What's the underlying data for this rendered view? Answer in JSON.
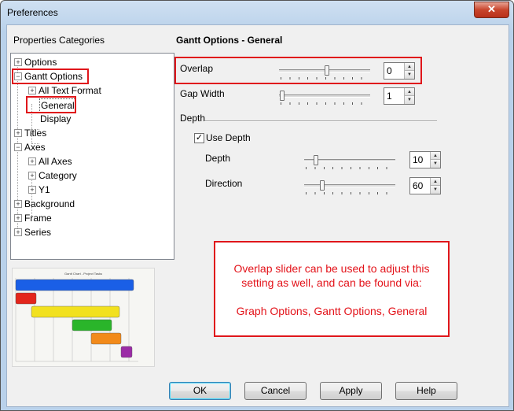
{
  "window": {
    "title": "Preferences",
    "close_symbol": "✕"
  },
  "left_panel": {
    "label": "Properties Categories",
    "tree": [
      {
        "label": "Options",
        "expander": "+"
      },
      {
        "label": "Gantt Options",
        "expander": "−"
      },
      {
        "label": "All Text Format",
        "expander": "+"
      },
      {
        "label": "General"
      },
      {
        "label": "Display"
      },
      {
        "label": "Titles",
        "expander": "+"
      },
      {
        "label": "Axes",
        "expander": "−"
      },
      {
        "label": "All Axes",
        "expander": "+"
      },
      {
        "label": "Category",
        "expander": "+"
      },
      {
        "label": "Y1",
        "expander": "+"
      },
      {
        "label": "Background",
        "expander": "+"
      },
      {
        "label": "Frame",
        "expander": "+"
      },
      {
        "label": "Series",
        "expander": "+"
      }
    ]
  },
  "preview": {
    "title": "Gantt Chart - Project Tasks",
    "bar_colors": [
      "#1a5fe6",
      "#e3261c",
      "#f2e11e",
      "#2ab52a",
      "#f28a1a",
      "#9b2ca6"
    ]
  },
  "right_panel": {
    "section_title": "Gantt Options - General",
    "overlap": {
      "label": "Overlap",
      "value": "0"
    },
    "gap_width": {
      "label": "Gap Width",
      "value": "1"
    },
    "depth_group": {
      "label": "Depth"
    },
    "use_depth": {
      "label": "Use Depth",
      "checked": true,
      "check_mark": "✓"
    },
    "depth": {
      "label": "Depth",
      "value": "10"
    },
    "direction": {
      "label": "Direction",
      "value": "60"
    }
  },
  "callout": {
    "line1": "Overlap slider can be used to adjust this",
    "line2": "setting as well, and can be found via:",
    "line3": "Graph Options, Gantt Options, General"
  },
  "buttons": {
    "ok": "OK",
    "cancel": "Cancel",
    "apply": "Apply",
    "help": "Help"
  },
  "spinner": {
    "up": "▲",
    "down": "▼"
  },
  "colors": {
    "highlight_red": "#e0161b"
  }
}
